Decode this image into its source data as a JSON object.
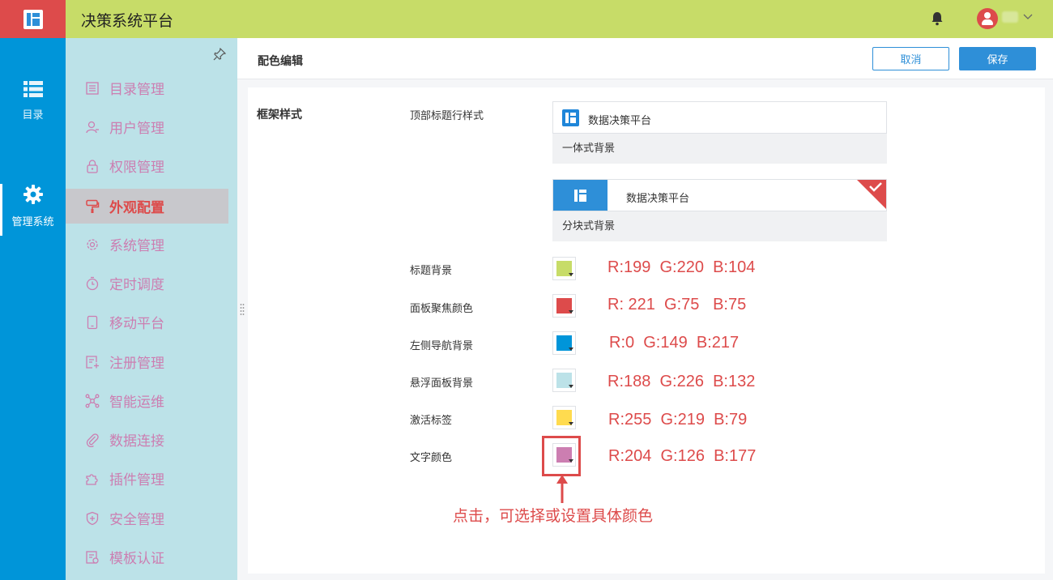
{
  "app": {
    "title": "决策系统平台"
  },
  "leftnav": {
    "catalog_label": "目录",
    "admin_label": "管理系统"
  },
  "submenu": {
    "items": [
      {
        "label": "目录管理",
        "icon": "catalog-list-icon"
      },
      {
        "label": "用户管理",
        "icon": "user-icon"
      },
      {
        "label": "权限管理",
        "icon": "lock-icon"
      },
      {
        "label": "外观配置",
        "icon": "paint-roller-icon",
        "active": true
      },
      {
        "label": "系统管理",
        "icon": "gear-icon"
      },
      {
        "label": "定时调度",
        "icon": "timer-icon"
      },
      {
        "label": "移动平台",
        "icon": "tablet-icon"
      },
      {
        "label": "注册管理",
        "icon": "register-icon"
      },
      {
        "label": "智能运维",
        "icon": "network-icon"
      },
      {
        "label": "数据连接",
        "icon": "paperclip-icon"
      },
      {
        "label": "插件管理",
        "icon": "puzzle-icon"
      },
      {
        "label": "安全管理",
        "icon": "shield-icon"
      },
      {
        "label": "模板认证",
        "icon": "template-cert-icon"
      }
    ]
  },
  "main": {
    "title": "配色编辑",
    "cancel_label": "取消",
    "save_label": "保存",
    "section_title": "框架样式",
    "header_style_label": "顶部标题行样式",
    "card_integrated": {
      "name": "数据决策平台",
      "caption": "一体式背景"
    },
    "card_block": {
      "name": "数据决策平台",
      "caption": "分块式背景",
      "selected": true
    },
    "colors": [
      {
        "label": "标题背景",
        "hex": "#c7dc68",
        "rgb_text": "R:199  G:220  B:104"
      },
      {
        "label": "面板聚焦颜色",
        "hex": "#dd4b4b",
        "rgb_text": "R: 221  G:75   B:75"
      },
      {
        "label": "左侧导航背景",
        "hex": "#0095d9",
        "rgb_text": "R:0  G:149  B:217"
      },
      {
        "label": "悬浮面板背景",
        "hex": "#bce2e8",
        "rgb_text": "R:188  G:226  B:132"
      },
      {
        "label": "激活标签",
        "hex": "#ffdb4f",
        "rgb_text": "R:255  G:219  B:79"
      },
      {
        "label": "文字颜色",
        "hex": "#cc7eb1",
        "rgb_text": "R:204  G:126  B:177"
      }
    ],
    "annotation": "点击，可选择或设置具体颜色"
  }
}
